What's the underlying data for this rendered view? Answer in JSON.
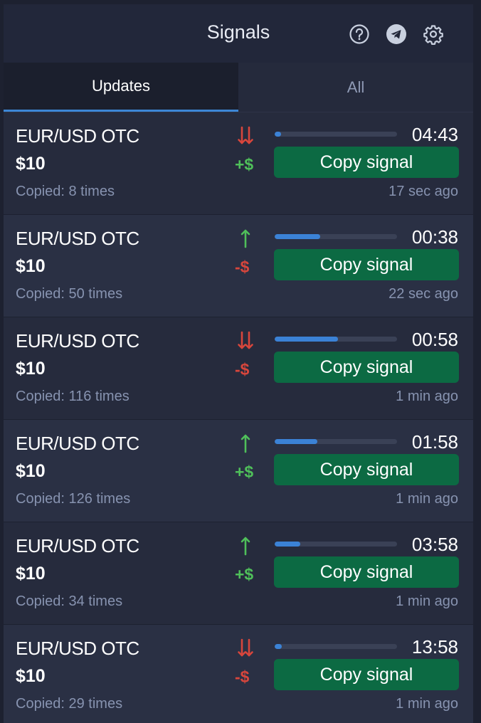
{
  "header": {
    "title": "Signals",
    "icons": [
      "help-circle-icon",
      "telegram-icon",
      "gear-icon"
    ]
  },
  "tabs": [
    {
      "label": "Updates",
      "active": true
    },
    {
      "label": "All",
      "active": false
    }
  ],
  "colors": {
    "accent_blue": "#3b82d6",
    "copy_button_green": "#0c6a43",
    "up_green": "#4fbf5a",
    "down_red": "#d8463c"
  },
  "signals": [
    {
      "pair": "EUR/USD OTC",
      "amount": "$10",
      "copied": "Copied: 8 times",
      "direction": "down",
      "result": "+$",
      "result_type": "up",
      "progress": 0.05,
      "timer": "04:43",
      "button": "Copy signal",
      "ago": "17 sec ago"
    },
    {
      "pair": "EUR/USD OTC",
      "amount": "$10",
      "copied": "Copied: 50 times",
      "direction": "up",
      "result": "-$",
      "result_type": "down",
      "progress": 0.37,
      "timer": "00:38",
      "button": "Copy signal",
      "ago": "22 sec ago"
    },
    {
      "pair": "EUR/USD OTC",
      "amount": "$10",
      "copied": "Copied: 116 times",
      "direction": "down",
      "result": "-$",
      "result_type": "down",
      "progress": 0.52,
      "timer": "00:58",
      "button": "Copy signal",
      "ago": "1 min ago"
    },
    {
      "pair": "EUR/USD OTC",
      "amount": "$10",
      "copied": "Copied: 126 times",
      "direction": "up",
      "result": "+$",
      "result_type": "up",
      "progress": 0.35,
      "timer": "01:58",
      "button": "Copy signal",
      "ago": "1 min ago"
    },
    {
      "pair": "EUR/USD OTC",
      "amount": "$10",
      "copied": "Copied: 34 times",
      "direction": "up",
      "result": "+$",
      "result_type": "up",
      "progress": 0.21,
      "timer": "03:58",
      "button": "Copy signal",
      "ago": "1 min ago"
    },
    {
      "pair": "EUR/USD OTC",
      "amount": "$10",
      "copied": "Copied: 29 times",
      "direction": "down",
      "result": "-$",
      "result_type": "down",
      "progress": 0.06,
      "timer": "13:58",
      "button": "Copy signal",
      "ago": "1 min ago"
    }
  ]
}
